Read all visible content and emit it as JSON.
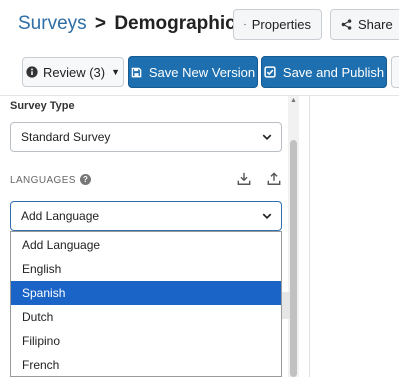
{
  "header": {
    "breadcrumb_parent": "Surveys",
    "breadcrumb_separator": ">",
    "breadcrumb_current": "Demographics",
    "properties_label": "Properties",
    "share_label": "Share"
  },
  "toolbar": {
    "review_label": "Review (3)",
    "save_new_version_label": "Save New Version",
    "save_publish_label": "Save and Publish"
  },
  "panel": {
    "survey_type_label": "Survey Type",
    "survey_type_value": "Standard Survey",
    "languages_label": "LANGUAGES",
    "language_select_value": "Add Language",
    "language_options": [
      "Add Language",
      "English",
      "Spanish",
      "Dutch",
      "Filipino",
      "French"
    ],
    "highlighted_option": "Spanish"
  },
  "colors": {
    "primary_button": "#1d6fb0",
    "link": "#2d6ea6",
    "highlight": "#1a63c7"
  },
  "icons": [
    "gear-icon",
    "share-icon",
    "info-icon",
    "save-icon",
    "check-square-icon",
    "help-icon",
    "download-icon",
    "upload-icon",
    "chevron-down-icon"
  ]
}
